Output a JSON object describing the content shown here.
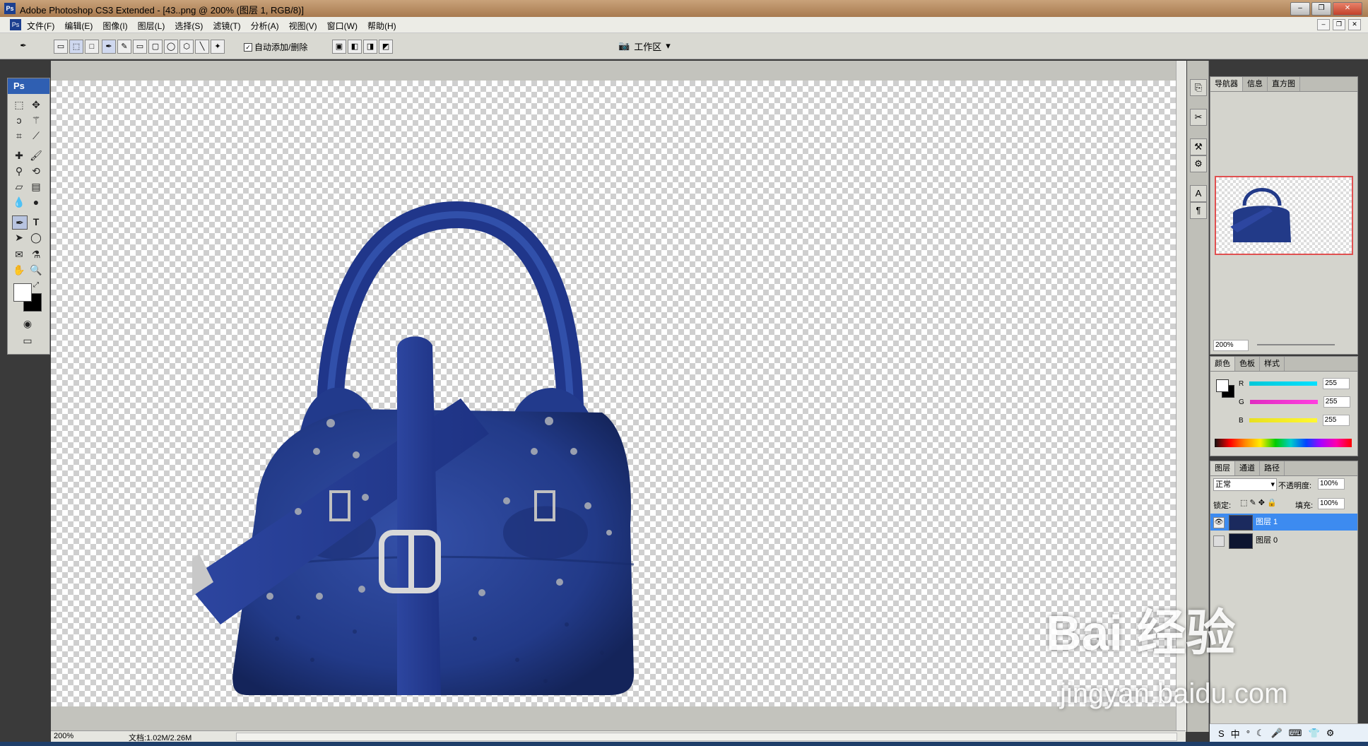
{
  "window": {
    "title": "Adobe Photoshop CS3 Extended - [43..png @ 200% (图层 1, RGB/8)]",
    "app_badge": "Ps"
  },
  "menu": [
    "文件(F)",
    "编辑(E)",
    "图像(I)",
    "图层(L)",
    "选择(S)",
    "滤镜(T)",
    "分析(A)",
    "视图(V)",
    "窗口(W)",
    "帮助(H)"
  ],
  "options": {
    "auto_add_delete": "自动添加/删除",
    "workspace": "工作区"
  },
  "toolbox": {
    "badge": "Ps"
  },
  "status": {
    "zoom": "200%",
    "doc": "文档:1.02M/2.26M"
  },
  "navigator": {
    "tabs": [
      "导航器",
      "信息",
      "直方图"
    ],
    "zoom": "200%"
  },
  "color_panel": {
    "tabs": [
      "颜色",
      "色板",
      "样式"
    ],
    "channels": [
      {
        "label": "R",
        "value": "255",
        "color": "#00c8d8"
      },
      {
        "label": "G",
        "value": "255",
        "color": "#e02cc0"
      },
      {
        "label": "B",
        "value": "255",
        "color": "#e8e020"
      }
    ]
  },
  "layers_panel": {
    "tabs": [
      "图层",
      "通道",
      "路径"
    ],
    "blend_mode": "正常",
    "opacity_label": "不透明度:",
    "opacity_value": "100%",
    "lock_label": "锁定:",
    "fill_label": "填充:",
    "fill_value": "100%",
    "layers": [
      {
        "name": "图层 1",
        "selected": true,
        "visible": true
      },
      {
        "name": "图层 0",
        "selected": false,
        "visible": false
      }
    ]
  },
  "watermark": {
    "main": "Bai 经验",
    "sub": "jingyan.baidu.com"
  },
  "colors": {
    "bag": "#233a8a",
    "selection": "#3d8bf0",
    "title_bar": "#b88b5f"
  }
}
